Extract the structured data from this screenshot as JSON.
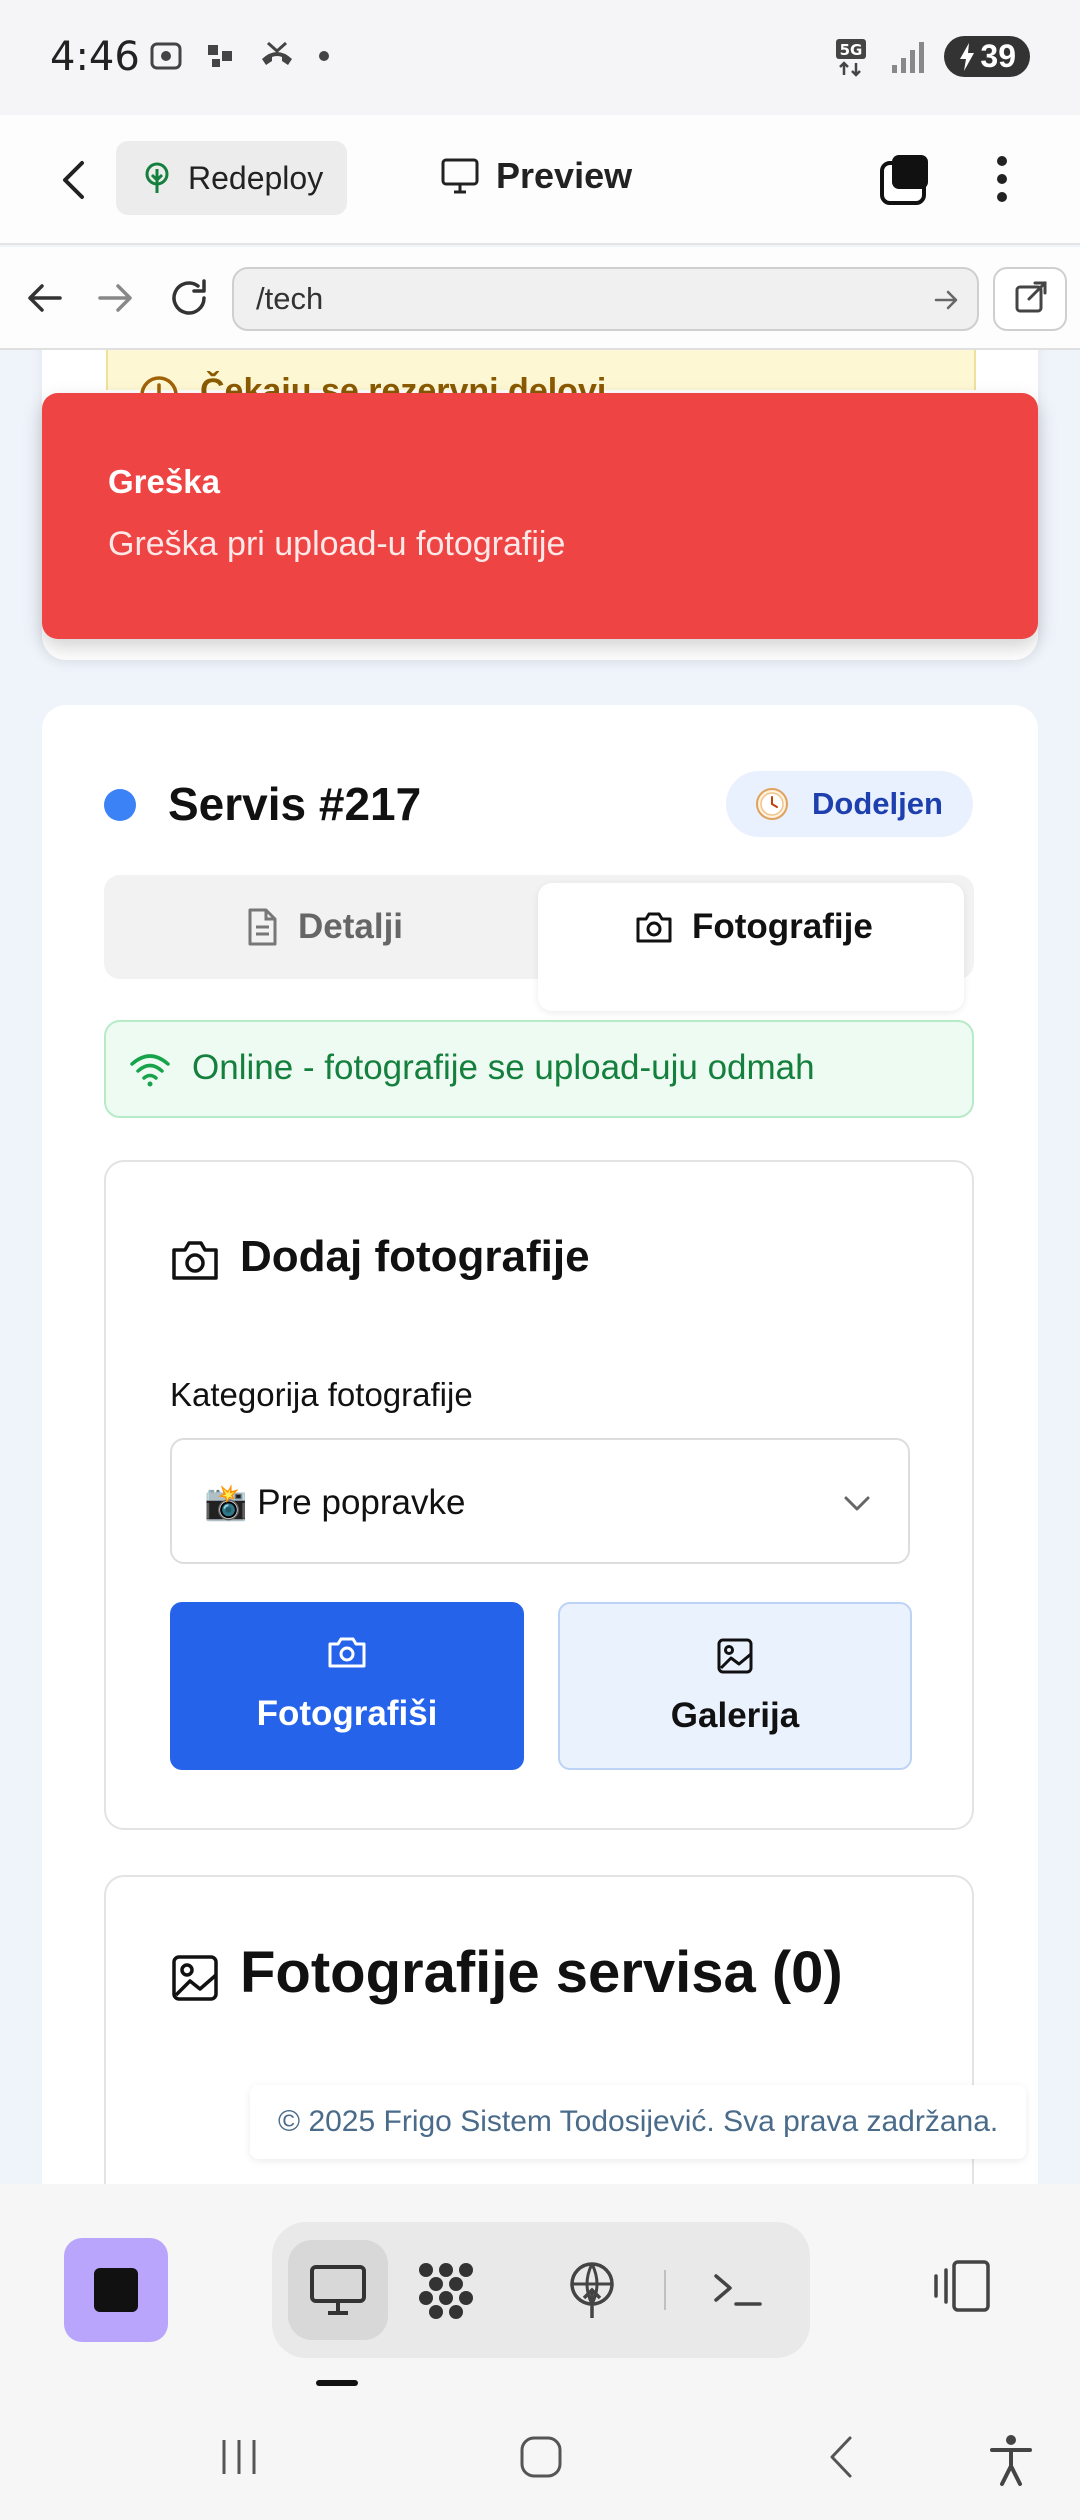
{
  "status_bar": {
    "time": "4:46",
    "network": "5G",
    "battery": "39"
  },
  "app_bar": {
    "redeploy_label": "Redeploy",
    "preview_label": "Preview"
  },
  "browser": {
    "url": "/tech"
  },
  "warning": {
    "text": "Čekaju se rezervni delovi"
  },
  "toast": {
    "title": "Greška",
    "message": "Greška pri upload-u fotografije"
  },
  "service": {
    "title": "Servis #217",
    "status": "Dodeljen",
    "accent_color": "#3b82f6"
  },
  "tabs": [
    {
      "label": "Detalji",
      "icon": "document-icon",
      "active": false
    },
    {
      "label": "Fotografije",
      "icon": "camera-icon",
      "active": true
    }
  ],
  "online_banner": {
    "text": "Online - fotografije se upload-uju odmah",
    "icon": "wifi-icon"
  },
  "add_photos": {
    "title": "Dodaj fotografije",
    "category_label": "Kategorija fotografije",
    "category_value": "📸 Pre popravke",
    "camera_button": "Fotografiši",
    "gallery_button": "Galerija"
  },
  "photos_section": {
    "title": "Fotografije servisa (0)"
  },
  "footer": {
    "text": "© 2025 Frigo Sistem Todosijević. Sva prava zadržana."
  },
  "colors": {
    "error": "#ef4444",
    "primary": "#2563eb",
    "success": "#15803d"
  }
}
